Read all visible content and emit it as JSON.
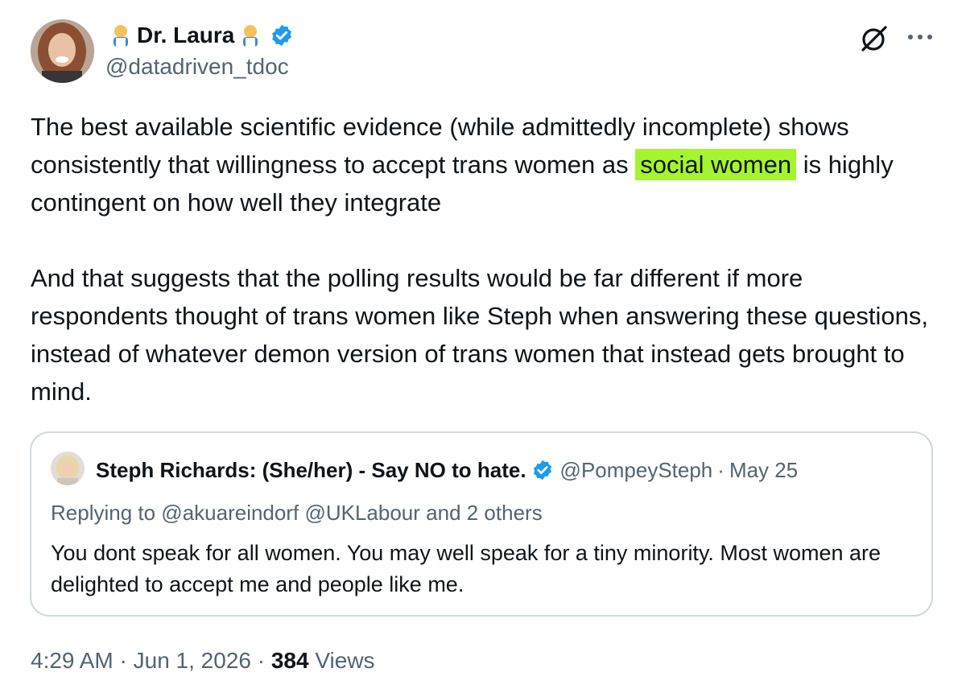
{
  "author": {
    "display_name": "Dr. Laura",
    "handle": "@datadriven_tdoc",
    "verified": true,
    "name_emoji": "scientist-emoji",
    "verified_color": "#1d9bf0"
  },
  "actions": {
    "grok_icon": "grok-icon",
    "more_icon": "more-icon"
  },
  "tweet": {
    "p1_before": "The best available scientific evidence (while admittedly incomplete) shows consistently that willingness to accept trans women as ",
    "p1_highlight": "social women",
    "p1_after": " is highly contingent on how well they integrate",
    "p2": "And that suggests that the polling results would be far different if more respondents thought of trans women like Steph when answering these questions, instead of whatever demon version of trans women that instead gets brought to mind.",
    "highlight_color": "#a5f52e"
  },
  "quoted": {
    "display_name": "Steph Richards: (She/her) - Say NO to hate.",
    "handle": "@PompeySteph",
    "separator": "·",
    "date": "May 25",
    "verified": true,
    "replying_to": "Replying to @akuareindorf @UKLabour and 2 others",
    "text": "You dont speak for all women. You may well speak for a tiny minority. Most women are delighted to accept me and people like me."
  },
  "meta": {
    "time": "4:29 AM",
    "separator": "·",
    "date": "Jun 1, 2026",
    "views_count": "384",
    "views_label": "Views"
  }
}
